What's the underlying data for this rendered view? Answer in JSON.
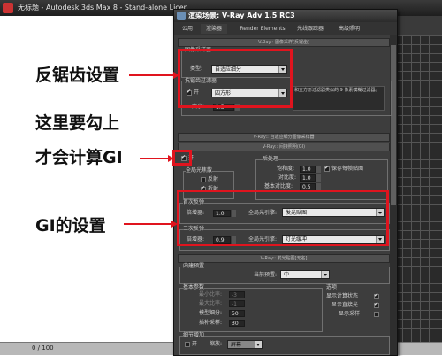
{
  "max": {
    "title": "无标题 - Autodesk 3ds Max 8 - Stand-alone Licen",
    "status": "0 / 100"
  },
  "dialog": {
    "title": "渲染场景: V-Ray Adv 1.5 RC3",
    "tabs": [
      "公用",
      "渲染器",
      "Render Elements",
      "光线跟踪器",
      "高级照明"
    ],
    "antialias": {
      "rollout": "V-Ray:: 图像采样(反锯齿)",
      "sampler_group": "图像采样器",
      "type_label": "类型:",
      "type_value": "自适应细分",
      "filter_group": "抗锯齿过滤器",
      "filter_on_label": "开",
      "filter_value": "四方形",
      "size_label": "大小:",
      "size_value": "1.5",
      "desc": "和立方形过滤器类似的 9 像素模糊过滤器。"
    },
    "subdiv_rollout": "V-Ray:: 自适应细分图像采样器",
    "gi": {
      "rollout": "V-Ray:: 间接照明(GI)",
      "on_label": "开",
      "caustics_group": "全局光焦散",
      "reflect_label": "反射",
      "refract_label": "折射",
      "post_group": "后处理",
      "saturation_label": "饱和度:",
      "saturation_value": "1.0",
      "save_map_label": "保存每帧贴图",
      "contrast_label": "对比度:",
      "contrast_value": "1.0",
      "contrast_base_label": "基本对比度:",
      "contrast_base_value": "0.5",
      "primary_group": "首次反弹",
      "primary_mult_label": "倍增器:",
      "primary_mult_value": "1.0",
      "primary_engine_label": "全局光引擎:",
      "primary_engine_value": "发光贴图",
      "secondary_group": "二次反弹",
      "secondary_mult_label": "倍增器:",
      "secondary_mult_value": "0.9",
      "secondary_engine_label": "全局光引擎:",
      "secondary_engine_value": "灯光缓冲"
    },
    "irradiance": {
      "rollout": "V-Ray:: 发光贴图[无名]",
      "preset_group": "内建预置",
      "preset_label": "当前预置:",
      "preset_value": "中",
      "basic_group": "基本参数",
      "min_rate_label": "最小比率:",
      "min_rate_value": "-3",
      "max_rate_label": "最大比率:",
      "max_rate_value": "-1",
      "model_subdiv_label": "模型细分:",
      "model_subdiv_value": "50",
      "interp_label": "插补采样:",
      "interp_value": "30",
      "options_group": "选项",
      "show_calc_label": "显示计算状态",
      "show_direct_label": "显示直接光",
      "show_samples_label": "显示采样",
      "detail_group": "细节增加",
      "detail_on_label": "开",
      "scale_label": "缩放:",
      "scale_value": "屏幕"
    }
  },
  "annotations": {
    "antialias": "反锯齿设置",
    "check_line1": "这里要勾上",
    "check_line2": "才会计算GI",
    "gi_settings": "GI的设置"
  },
  "colors": {
    "accent_red": "#e0141e",
    "dialog_bg": "#3d3d3d"
  }
}
